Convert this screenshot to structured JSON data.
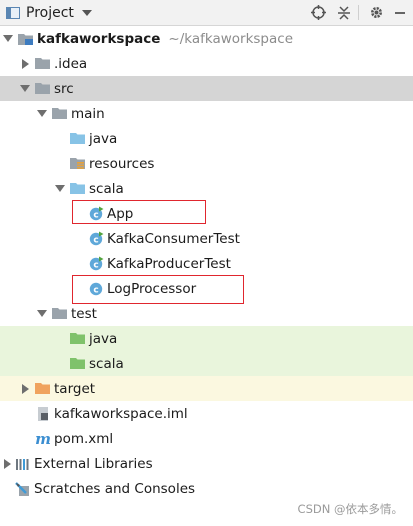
{
  "panel": {
    "title": "Project"
  },
  "tree": {
    "root": {
      "name": "kafkaworkspace",
      "path": "~/kafkaworkspace"
    },
    "idea": ".idea",
    "src": "src",
    "main": "main",
    "main_java": "java",
    "resources": "resources",
    "scala": "scala",
    "app": "App",
    "consumer": "KafkaConsumerTest",
    "producer": "KafkaProducerTest",
    "log": "LogProcessor",
    "test": "test",
    "test_java": "java",
    "test_scala": "scala",
    "target": "target",
    "iml": "kafkaworkspace.iml",
    "pom": "pom.xml",
    "external": "External Libraries",
    "scratches": "Scratches and Consoles"
  },
  "watermark": "CSDN @依本多情。",
  "colors": {
    "selected_row": "#d5d5d5",
    "test_bg": "#e9f5dc",
    "target_bg": "#fbf8e0",
    "folder_gray": "#9aa3ab",
    "source_blue": "#87c3e6",
    "test_green": "#7fc26b",
    "excluded_orange": "#f0a35e",
    "highlight_red": "#e0262e"
  },
  "icons": {
    "panel": "project-panel-icon",
    "dropdown": "dropdown-arrow-icon",
    "locate": "locate-crosshair-icon",
    "collapse": "collapse-all-icon",
    "settings": "gear-icon",
    "hide": "hide-minus-icon",
    "scala_class": "scala-class-icon",
    "maven": "maven-m-icon",
    "libraries": "library-bars-icon",
    "scratches": "scratches-icon"
  }
}
